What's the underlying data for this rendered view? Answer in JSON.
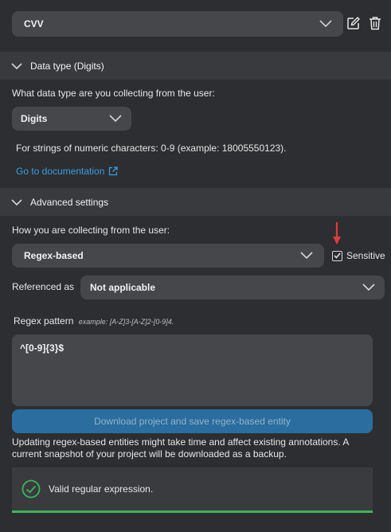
{
  "entity": {
    "name": "CVV"
  },
  "data_type": {
    "header": "Data type (Digits)",
    "question": "What data type are you collecting from the user:",
    "selected": "Digits",
    "description": "For strings of numeric characters: 0-9 (example: 18005550123).",
    "doc_link": "Go to documentation"
  },
  "advanced": {
    "header": "Advanced settings",
    "how_label": "How you are collecting from the user:",
    "method_selected": "Regex-based",
    "sensitive_label": "Sensitive",
    "sensitive_checked": true,
    "referenced_label": "Referenced as",
    "referenced_selected": "Not applicable",
    "regex_label": "Regex pattern",
    "regex_example": "example: [A-Z]3-[A-Z]2-[0-9]4.",
    "regex_value": "^[0-9]{3}$",
    "download_button": "Download project and save regex-based entity",
    "note": "Updating regex-based entities might take time and affect existing annotations. A current snapshot of your project will be downloaded as a backup.",
    "validation_message": "Valid regular expression."
  },
  "colors": {
    "accent": "#2a6d9e",
    "link": "#3a9de0",
    "success": "#3cb558",
    "annotation_arrow": "#e23b3b"
  },
  "icons": [
    "chevron-down-icon",
    "edit-icon",
    "trash-icon",
    "external-link-icon",
    "checkbox-icon",
    "check-circle-icon",
    "arrow-down-icon"
  ]
}
